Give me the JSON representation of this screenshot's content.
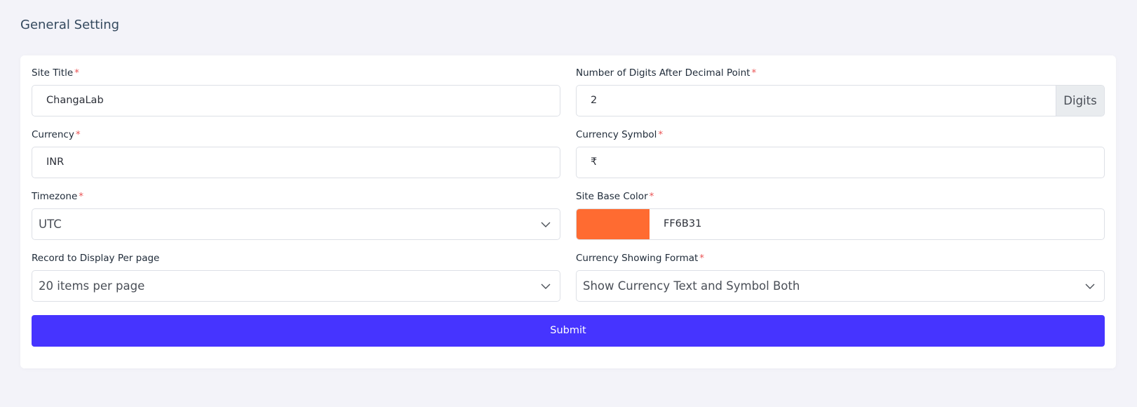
{
  "page": {
    "title": "General Setting"
  },
  "form": {
    "site_title": {
      "label": "Site Title",
      "required": "*",
      "value": "ChangaLab"
    },
    "digits": {
      "label": "Number of Digits After Decimal Point",
      "required": "*",
      "value": "2",
      "addon": "Digits"
    },
    "currency": {
      "label": "Currency",
      "required": "*",
      "value": "INR"
    },
    "currency_symbol": {
      "label": "Currency Symbol",
      "required": "*",
      "value": "₹"
    },
    "timezone": {
      "label": "Timezone",
      "required": "*",
      "selected": "UTC",
      "icon": "chevron-down-icon"
    },
    "base_color": {
      "label": "Site Base Color",
      "required": "*",
      "value": "FF6B31",
      "swatch": "#ff6b31"
    },
    "per_page": {
      "label": "Record to Display Per page",
      "selected": "20 items per page",
      "icon": "chevron-down-icon"
    },
    "currency_format": {
      "label": "Currency Showing Format",
      "required": "*",
      "selected": "Show Currency Text and Symbol Both",
      "icon": "chevron-down-icon"
    },
    "submit_label": "Submit"
  },
  "colors": {
    "accent": "#4634ff",
    "required": "#ea5455",
    "background": "#f3f3f9"
  }
}
